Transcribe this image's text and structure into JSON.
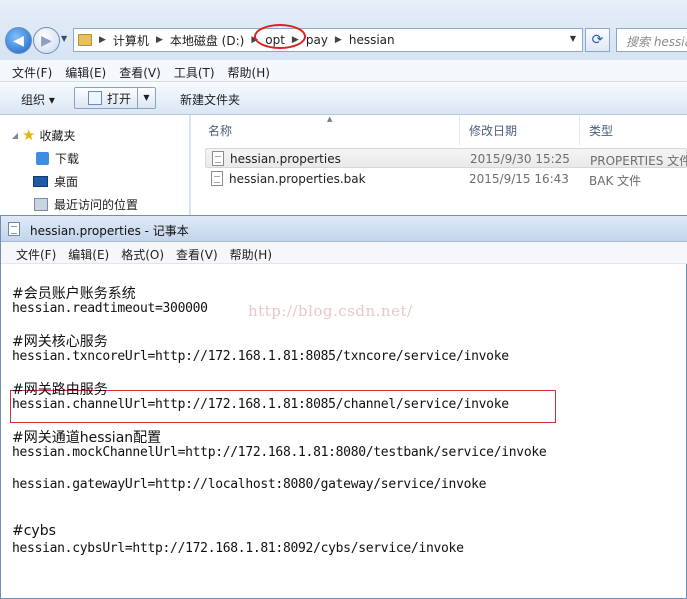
{
  "explorer": {
    "breadcrumb": [
      "计算机",
      "本地磁盘 (D:)",
      "opt",
      "pay",
      "hessian"
    ],
    "search_placeholder": "搜索 hessian",
    "menu": [
      "文件(F)",
      "编辑(E)",
      "查看(V)",
      "工具(T)",
      "帮助(H)"
    ],
    "toolbar": {
      "organize": "组织 ▾",
      "open": "打开",
      "new_folder": "新建文件夹"
    },
    "nav": {
      "favorites": "收藏夹",
      "downloads": "下载",
      "desktop": "桌面",
      "recent": "最近访问的位置"
    },
    "columns": {
      "name": "名称",
      "modified": "修改日期",
      "type": "类型"
    },
    "files": [
      {
        "name": "hessian.properties",
        "modified": "2015/9/30 15:25",
        "type": "PROPERTIES 文件"
      },
      {
        "name": "hessian.properties.bak",
        "modified": "2015/9/15 16:43",
        "type": "BAK 文件"
      }
    ]
  },
  "notepad": {
    "title": "hessian.properties - 记事本",
    "menu": [
      "文件(F)",
      "编辑(E)",
      "格式(O)",
      "查看(V)",
      "帮助(H)"
    ],
    "watermark": "http://blog.csdn.net/",
    "lines": [
      "#会员账户账务系统",
      "hessian.readtimeout=300000",
      "#网关核心服务",
      "hessian.txncoreUrl=http://172.168.1.81:8085/txncore/service/invoke",
      "#网关路由服务",
      "hessian.channelUrl=http://172.168.1.81:8085/channel/service/invoke",
      "#网关通道hessian配置",
      "hessian.mockChannelUrl=http://172.168.1.81:8080/testbank/service/invoke",
      "hessian.gatewayUrl=http://localhost:8080/gateway/service/invoke",
      "#cybs",
      "hessian.cybsUrl=http://172.168.1.81:8092/cybs/service/invoke"
    ]
  },
  "colors": {
    "annotation_red": "#e02020",
    "window_blue": "#dce7f4"
  }
}
